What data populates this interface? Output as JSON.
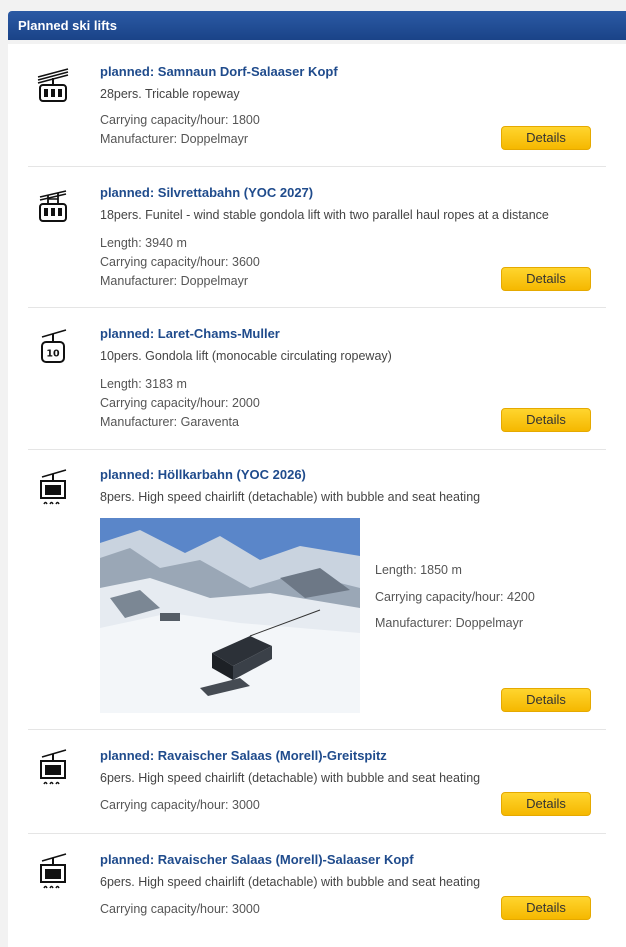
{
  "section_title": "Planned ski lifts",
  "details_label": "Details",
  "lifts": [
    {
      "icon": "tricable-ropeway-icon",
      "title": "planned: Samnaun Dorf-Salaaser Kopf",
      "description": "28pers. Tricable ropeway",
      "capacity": "Carrying capacity/hour: 1800",
      "manufacturer": "Manufacturer: Doppelmayr"
    },
    {
      "icon": "funitel-icon",
      "title": "planned: Silvrettabahn (YOC 2027)",
      "description": "18pers. Funitel - wind stable gondola lift with two parallel haul ropes at a distance",
      "length": "Length: 3940 m",
      "capacity": "Carrying capacity/hour: 3600",
      "manufacturer": "Manufacturer: Doppelmayr"
    },
    {
      "icon": "gondola-icon",
      "icon_label": "10",
      "title": "planned: Laret-Chams-Muller",
      "description": "10pers. Gondola lift (monocable circulating ropeway)",
      "length": "Length: 3183 m",
      "capacity": "Carrying capacity/hour: 2000",
      "manufacturer": "Manufacturer: Garaventa"
    },
    {
      "icon": "chairlift-bubble-heated-icon",
      "title": "planned: Höllkarbahn (YOC 2026)",
      "description": "8pers. High speed chairlift (detachable) with bubble and seat heating",
      "length": "Length: 1850 m",
      "capacity": "Carrying capacity/hour: 4200",
      "manufacturer": "Manufacturer: Doppelmayr"
    },
    {
      "icon": "chairlift-bubble-heated-icon",
      "title": "planned: Ravaischer Salaas (Morell)-Greitspitz",
      "description": "6pers. High speed chairlift (detachable) with bubble and seat heating",
      "capacity": "Carrying capacity/hour: 3000"
    },
    {
      "icon": "chairlift-bubble-heated-icon",
      "title": "planned: Ravaischer Salaas (Morell)-Salaaser Kopf",
      "description": "6pers. High speed chairlift (detachable) with bubble and seat heating",
      "capacity": "Carrying capacity/hour: 3000"
    }
  ]
}
